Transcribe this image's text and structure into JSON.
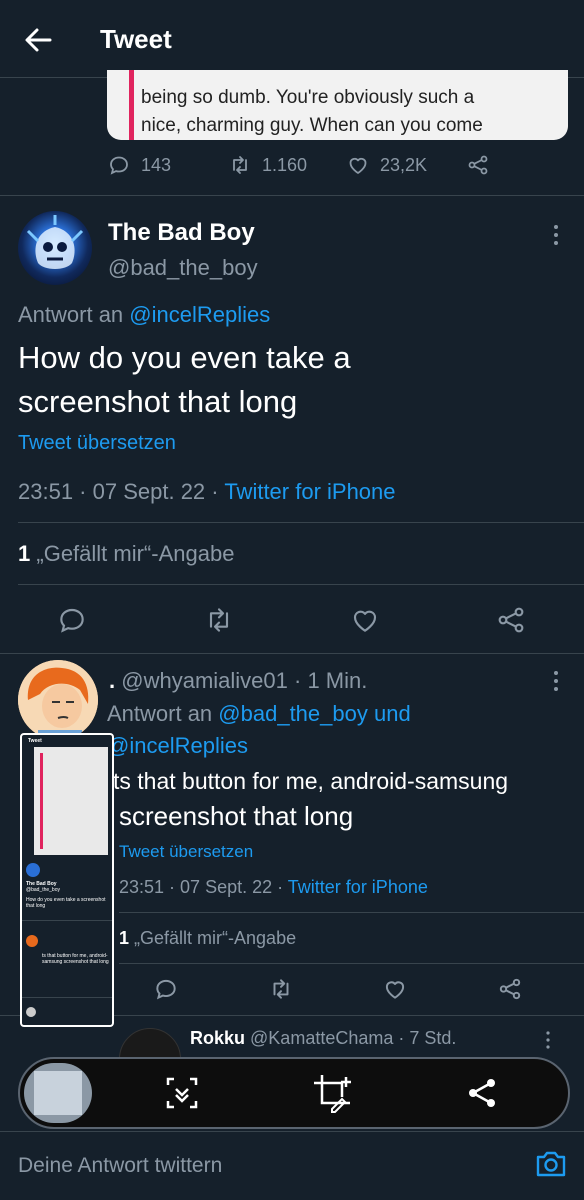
{
  "header": {
    "title": "Tweet"
  },
  "quoted_image": {
    "lines": [
      "being so dumb. You're obviously such a",
      "nice, charming guy. When can you come"
    ]
  },
  "quote_stats": {
    "replies": "143",
    "retweets": "1.160",
    "likes": "23,2K"
  },
  "main_tweet": {
    "name": "The Bad Boy",
    "handle": "@bad_the_boy",
    "reply_prefix": "Antwort an",
    "reply_to": "@incelReplies",
    "text_line1": "How do you even take a",
    "text_line2": "screenshot that long",
    "translate": "Tweet übersetzen",
    "time": "23:51",
    "date": "07 Sept. 22",
    "source": "Twitter for iPhone",
    "likes_count": "1",
    "likes_label": "„Gefällt mir“-Angabe"
  },
  "reply_tweet": {
    "name": ".",
    "handle": "@whyamialive01",
    "age": "1 Min.",
    "reply_prefix": "Antwort an",
    "reply_to_1": "@bad_the_boy",
    "reply_and": "und",
    "reply_to_2": "@incelReplies",
    "text_line1": "ts that button for me, android-samsung",
    "text_line2": "screenshot that long",
    "translate": "Tweet übersetzen",
    "time": "23:51",
    "date": "07 Sept. 22",
    "source": "Twitter for iPhone",
    "likes_count": "1",
    "likes_label": "„Gefällt mir“-Angabe"
  },
  "next_tweet": {
    "name": "Rokku",
    "handle": "@KamatteChama",
    "age": "7 Std."
  },
  "reply_bar": {
    "placeholder": "Deine Antwort twittern"
  },
  "thumbnail": {
    "title": "Tweet",
    "name": "The Bad Boy",
    "handle": "@bad_the_boy",
    "text": "How do you even take a screenshot that long",
    "reply_text": "ts that button for me, android-samsung screenshot that long"
  },
  "colors": {
    "background": "#15202b",
    "accent": "#1d9bf0",
    "muted": "#8b98a5",
    "divider": "#38444d"
  }
}
